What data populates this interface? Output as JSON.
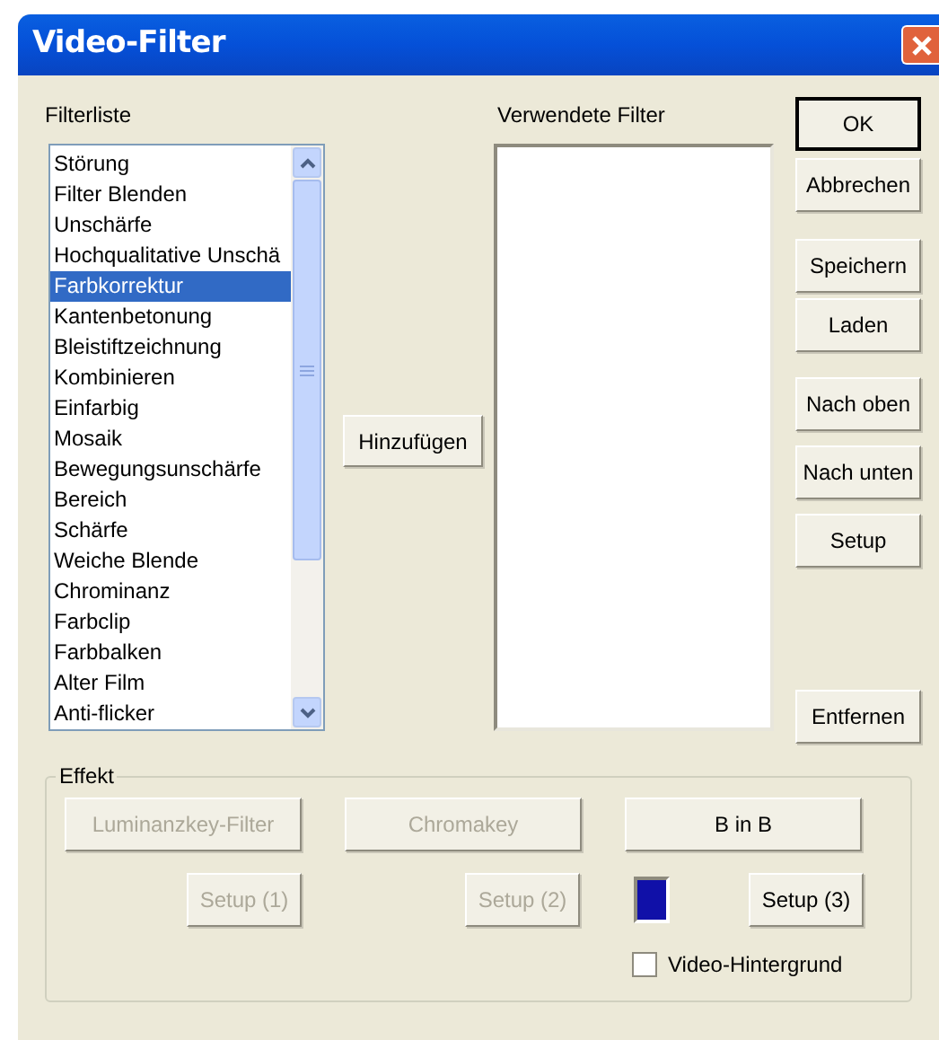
{
  "window": {
    "title": "Video-Filter"
  },
  "filter_list": {
    "label": "Filterliste",
    "items": [
      {
        "label": "Störung",
        "selected": false
      },
      {
        "label": "Filter Blenden",
        "selected": false
      },
      {
        "label": "Unschärfe",
        "selected": false
      },
      {
        "label": "Hochqualitative Unschä",
        "selected": false
      },
      {
        "label": "Farbkorrektur",
        "selected": true
      },
      {
        "label": "Kantenbetonung",
        "selected": false
      },
      {
        "label": "Bleistiftzeichnung",
        "selected": false
      },
      {
        "label": "Kombinieren",
        "selected": false
      },
      {
        "label": "Einfarbig",
        "selected": false
      },
      {
        "label": "Mosaik",
        "selected": false
      },
      {
        "label": "Bewegungsunschärfe",
        "selected": false
      },
      {
        "label": "Bereich",
        "selected": false
      },
      {
        "label": "Schärfe",
        "selected": false
      },
      {
        "label": "Weiche Blende",
        "selected": false
      },
      {
        "label": "Chrominanz",
        "selected": false
      },
      {
        "label": "Farbclip",
        "selected": false
      },
      {
        "label": "Farbbalken",
        "selected": false
      },
      {
        "label": "Alter Film",
        "selected": false
      },
      {
        "label": "Anti-flicker",
        "selected": false
      }
    ]
  },
  "add_button": {
    "label": "Hinzufügen"
  },
  "used_filters": {
    "label": "Verwendete Filter"
  },
  "side_buttons": [
    {
      "label": "OK",
      "default": true
    },
    {
      "label": "Abbrechen",
      "default": false
    },
    {
      "label": "Speichern",
      "default": false
    },
    {
      "label": "Laden",
      "default": false
    },
    {
      "label": "Nach oben",
      "default": false
    },
    {
      "label": "Nach unten",
      "default": false
    },
    {
      "label": "Setup",
      "default": false
    },
    {
      "label": "Entfernen",
      "default": false
    }
  ],
  "effect": {
    "label": "Effekt",
    "mode_buttons": [
      {
        "label": "Luminanzkey-Filter",
        "disabled": true
      },
      {
        "label": "Chromakey",
        "disabled": true
      },
      {
        "label": "B in B",
        "disabled": false
      }
    ],
    "setup_buttons": [
      {
        "label": "Setup (1)",
        "disabled": true
      },
      {
        "label": "Setup (2)",
        "disabled": true
      },
      {
        "label": "Setup (3)",
        "disabled": false
      }
    ],
    "swatch": {
      "color": "#1010a8"
    },
    "checkbox": {
      "label": "Video-Hintergrund",
      "checked": false
    }
  }
}
